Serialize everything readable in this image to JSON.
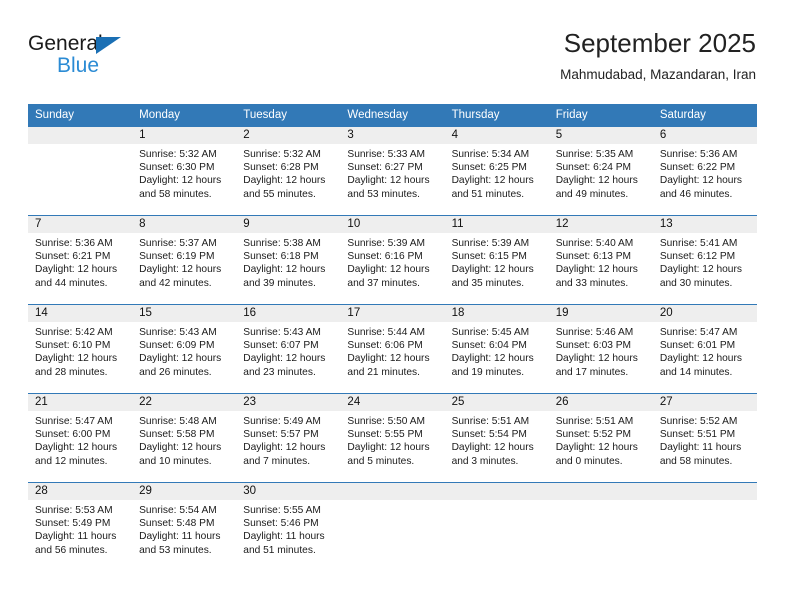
{
  "brand": {
    "name_part1": "General",
    "name_part2": "Blue",
    "triangle_color": "#1a6fb4",
    "blue_color": "#2b8bd4"
  },
  "header": {
    "month_title": "September 2025",
    "location": "Mahmudabad, Mazandaran, Iran"
  },
  "theme": {
    "header_row_bg": "#3279b7",
    "date_band_bg": "#eeeeee",
    "separator": "#3279b7"
  },
  "weekdays": [
    "Sunday",
    "Monday",
    "Tuesday",
    "Wednesday",
    "Thursday",
    "Friday",
    "Saturday"
  ],
  "weeks": [
    {
      "days": [
        {
          "num": "",
          "l1": "",
          "l2": "",
          "l3": "",
          "l4": ""
        },
        {
          "num": "1",
          "l1": "Sunrise: 5:32 AM",
          "l2": "Sunset: 6:30 PM",
          "l3": "Daylight: 12 hours",
          "l4": "and 58 minutes."
        },
        {
          "num": "2",
          "l1": "Sunrise: 5:32 AM",
          "l2": "Sunset: 6:28 PM",
          "l3": "Daylight: 12 hours",
          "l4": "and 55 minutes."
        },
        {
          "num": "3",
          "l1": "Sunrise: 5:33 AM",
          "l2": "Sunset: 6:27 PM",
          "l3": "Daylight: 12 hours",
          "l4": "and 53 minutes."
        },
        {
          "num": "4",
          "l1": "Sunrise: 5:34 AM",
          "l2": "Sunset: 6:25 PM",
          "l3": "Daylight: 12 hours",
          "l4": "and 51 minutes."
        },
        {
          "num": "5",
          "l1": "Sunrise: 5:35 AM",
          "l2": "Sunset: 6:24 PM",
          "l3": "Daylight: 12 hours",
          "l4": "and 49 minutes."
        },
        {
          "num": "6",
          "l1": "Sunrise: 5:36 AM",
          "l2": "Sunset: 6:22 PM",
          "l3": "Daylight: 12 hours",
          "l4": "and 46 minutes."
        }
      ]
    },
    {
      "days": [
        {
          "num": "7",
          "l1": "Sunrise: 5:36 AM",
          "l2": "Sunset: 6:21 PM",
          "l3": "Daylight: 12 hours",
          "l4": "and 44 minutes."
        },
        {
          "num": "8",
          "l1": "Sunrise: 5:37 AM",
          "l2": "Sunset: 6:19 PM",
          "l3": "Daylight: 12 hours",
          "l4": "and 42 minutes."
        },
        {
          "num": "9",
          "l1": "Sunrise: 5:38 AM",
          "l2": "Sunset: 6:18 PM",
          "l3": "Daylight: 12 hours",
          "l4": "and 39 minutes."
        },
        {
          "num": "10",
          "l1": "Sunrise: 5:39 AM",
          "l2": "Sunset: 6:16 PM",
          "l3": "Daylight: 12 hours",
          "l4": "and 37 minutes."
        },
        {
          "num": "11",
          "l1": "Sunrise: 5:39 AM",
          "l2": "Sunset: 6:15 PM",
          "l3": "Daylight: 12 hours",
          "l4": "and 35 minutes."
        },
        {
          "num": "12",
          "l1": "Sunrise: 5:40 AM",
          "l2": "Sunset: 6:13 PM",
          "l3": "Daylight: 12 hours",
          "l4": "and 33 minutes."
        },
        {
          "num": "13",
          "l1": "Sunrise: 5:41 AM",
          "l2": "Sunset: 6:12 PM",
          "l3": "Daylight: 12 hours",
          "l4": "and 30 minutes."
        }
      ]
    },
    {
      "days": [
        {
          "num": "14",
          "l1": "Sunrise: 5:42 AM",
          "l2": "Sunset: 6:10 PM",
          "l3": "Daylight: 12 hours",
          "l4": "and 28 minutes."
        },
        {
          "num": "15",
          "l1": "Sunrise: 5:43 AM",
          "l2": "Sunset: 6:09 PM",
          "l3": "Daylight: 12 hours",
          "l4": "and 26 minutes."
        },
        {
          "num": "16",
          "l1": "Sunrise: 5:43 AM",
          "l2": "Sunset: 6:07 PM",
          "l3": "Daylight: 12 hours",
          "l4": "and 23 minutes."
        },
        {
          "num": "17",
          "l1": "Sunrise: 5:44 AM",
          "l2": "Sunset: 6:06 PM",
          "l3": "Daylight: 12 hours",
          "l4": "and 21 minutes."
        },
        {
          "num": "18",
          "l1": "Sunrise: 5:45 AM",
          "l2": "Sunset: 6:04 PM",
          "l3": "Daylight: 12 hours",
          "l4": "and 19 minutes."
        },
        {
          "num": "19",
          "l1": "Sunrise: 5:46 AM",
          "l2": "Sunset: 6:03 PM",
          "l3": "Daylight: 12 hours",
          "l4": "and 17 minutes."
        },
        {
          "num": "20",
          "l1": "Sunrise: 5:47 AM",
          "l2": "Sunset: 6:01 PM",
          "l3": "Daylight: 12 hours",
          "l4": "and 14 minutes."
        }
      ]
    },
    {
      "days": [
        {
          "num": "21",
          "l1": "Sunrise: 5:47 AM",
          "l2": "Sunset: 6:00 PM",
          "l3": "Daylight: 12 hours",
          "l4": "and 12 minutes."
        },
        {
          "num": "22",
          "l1": "Sunrise: 5:48 AM",
          "l2": "Sunset: 5:58 PM",
          "l3": "Daylight: 12 hours",
          "l4": "and 10 minutes."
        },
        {
          "num": "23",
          "l1": "Sunrise: 5:49 AM",
          "l2": "Sunset: 5:57 PM",
          "l3": "Daylight: 12 hours",
          "l4": "and 7 minutes."
        },
        {
          "num": "24",
          "l1": "Sunrise: 5:50 AM",
          "l2": "Sunset: 5:55 PM",
          "l3": "Daylight: 12 hours",
          "l4": "and 5 minutes."
        },
        {
          "num": "25",
          "l1": "Sunrise: 5:51 AM",
          "l2": "Sunset: 5:54 PM",
          "l3": "Daylight: 12 hours",
          "l4": "and 3 minutes."
        },
        {
          "num": "26",
          "l1": "Sunrise: 5:51 AM",
          "l2": "Sunset: 5:52 PM",
          "l3": "Daylight: 12 hours",
          "l4": "and 0 minutes."
        },
        {
          "num": "27",
          "l1": "Sunrise: 5:52 AM",
          "l2": "Sunset: 5:51 PM",
          "l3": "Daylight: 11 hours",
          "l4": "and 58 minutes."
        }
      ]
    },
    {
      "days": [
        {
          "num": "28",
          "l1": "Sunrise: 5:53 AM",
          "l2": "Sunset: 5:49 PM",
          "l3": "Daylight: 11 hours",
          "l4": "and 56 minutes."
        },
        {
          "num": "29",
          "l1": "Sunrise: 5:54 AM",
          "l2": "Sunset: 5:48 PM",
          "l3": "Daylight: 11 hours",
          "l4": "and 53 minutes."
        },
        {
          "num": "30",
          "l1": "Sunrise: 5:55 AM",
          "l2": "Sunset: 5:46 PM",
          "l3": "Daylight: 11 hours",
          "l4": "and 51 minutes."
        },
        {
          "num": "",
          "l1": "",
          "l2": "",
          "l3": "",
          "l4": ""
        },
        {
          "num": "",
          "l1": "",
          "l2": "",
          "l3": "",
          "l4": ""
        },
        {
          "num": "",
          "l1": "",
          "l2": "",
          "l3": "",
          "l4": ""
        },
        {
          "num": "",
          "l1": "",
          "l2": "",
          "l3": "",
          "l4": ""
        }
      ]
    }
  ]
}
